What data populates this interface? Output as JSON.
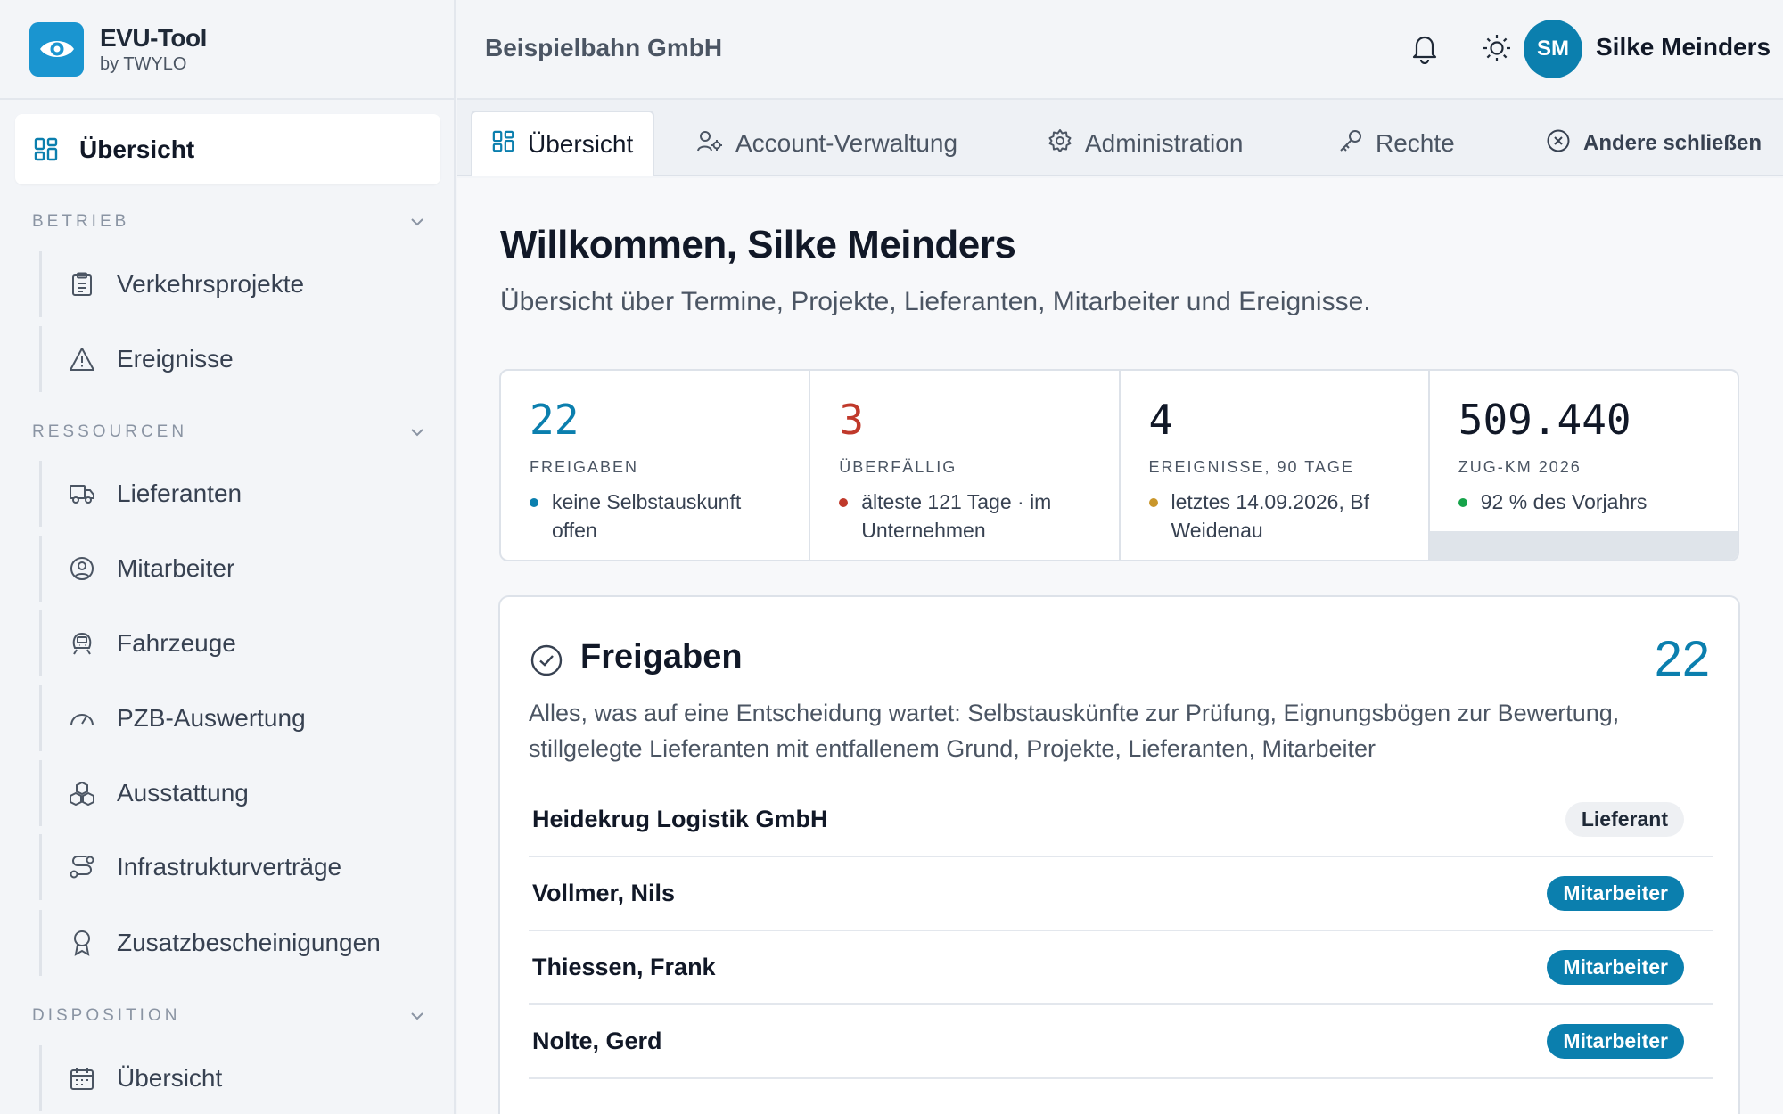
{
  "brand": {
    "name": "EVU-Tool",
    "sub": "by TWYLO"
  },
  "header": {
    "company": "Beispielbahn GmbH",
    "avatar_initials": "SM",
    "user_name": "Silke Meinders"
  },
  "sidebar": {
    "active": {
      "label": "Übersicht",
      "icon": "dashboard-icon"
    },
    "sections": [
      {
        "title": "BETRIEB",
        "items": [
          {
            "label": "Verkehrsprojekte",
            "icon": "clipboard-icon"
          },
          {
            "label": "Ereignisse",
            "icon": "warning-icon"
          }
        ]
      },
      {
        "title": "RESSOURCEN",
        "items": [
          {
            "label": "Lieferanten",
            "icon": "truck-icon"
          },
          {
            "label": "Mitarbeiter",
            "icon": "user-circle-icon"
          },
          {
            "label": "Fahrzeuge",
            "icon": "train-icon"
          },
          {
            "label": "PZB-Auswertung",
            "icon": "gauge-icon"
          },
          {
            "label": "Ausstattung",
            "icon": "boxes-icon"
          },
          {
            "label": "Infrastrukturverträge",
            "icon": "route-icon"
          },
          {
            "label": "Zusatzbescheinigungen",
            "icon": "award-icon"
          }
        ]
      },
      {
        "title": "DISPOSITION",
        "items": [
          {
            "label": "Übersicht",
            "icon": "calendar-icon"
          }
        ]
      }
    ]
  },
  "tabs": [
    {
      "label": "Übersicht",
      "icon": "dashboard-icon",
      "active": true
    },
    {
      "label": "Account-Verwaltung",
      "icon": "user-cog-icon"
    },
    {
      "label": "Administration",
      "icon": "gear-icon"
    },
    {
      "label": "Rechte",
      "icon": "key-icon"
    }
  ],
  "tab_close_label": "Andere schließen",
  "welcome": {
    "title": "Willkommen, Silke Meinders",
    "subtitle": "Übersicht über Termine, Projekte, Lieferanten, Mitarbeiter und Ereignisse."
  },
  "stats": [
    {
      "value": "22",
      "label": "FREIGABEN",
      "note": "keine Selbstauskunft offen",
      "value_color": "#0b7fae",
      "dot_color": "#0b7fae"
    },
    {
      "value": "3",
      "label": "ÜBERFÄLLIG",
      "note": "älteste 121 Tage · im Unternehmen",
      "value_color": "#c0392b",
      "dot_color": "#c0392b"
    },
    {
      "value": "4",
      "label": "EREIGNISSE, 90 TAGE",
      "note": "letztes 14.09.2026, Bf Weidenau",
      "value_color": "#111827",
      "dot_color": "#c9962b"
    },
    {
      "value": "509.440",
      "label": "ZUG-KM 2026",
      "note": "92 % des Vorjahrs",
      "value_color": "#111827",
      "dot_color": "#16a34a"
    }
  ],
  "approvals": {
    "title": "Freigaben",
    "count": "22",
    "description": "Alles, was auf eine Entscheidung wartet: Selbstauskünfte zur Prüfung, Eignungsbögen zur Bewertung, stillgelegte Lieferanten mit entfallenem Grund, Projekte, Lieferanten, Mitarbeiter",
    "rows": [
      {
        "name": "Heidekrug Logistik GmbH",
        "badge": "Lieferant",
        "badge_style": "gray"
      },
      {
        "name": "Vollmer, Nils",
        "badge": "Mitarbeiter",
        "badge_style": "blue"
      },
      {
        "name": "Thiessen, Frank",
        "badge": "Mitarbeiter",
        "badge_style": "blue"
      },
      {
        "name": "Nolte, Gerd",
        "badge": "Mitarbeiter",
        "badge_style": "blue"
      }
    ]
  }
}
